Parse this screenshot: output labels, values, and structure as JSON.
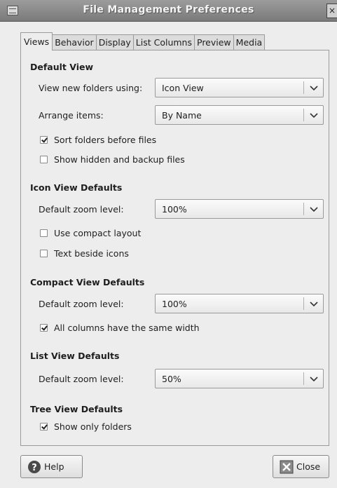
{
  "window": {
    "title": "File Management Preferences",
    "close_glyph": "×"
  },
  "tabs": [
    {
      "label": "Views",
      "active": true
    },
    {
      "label": "Behavior"
    },
    {
      "label": "Display"
    },
    {
      "label": "List Columns"
    },
    {
      "label": "Preview"
    },
    {
      "label": "Media"
    }
  ],
  "default_view": {
    "title": "Default View",
    "view_new_folders_label": "View new folders using:",
    "view_new_folders_value": "Icon View",
    "arrange_items_label": "Arrange items:",
    "arrange_items_value": "By Name",
    "sort_folders_label": "Sort folders before files",
    "sort_folders_checked": true,
    "show_hidden_label": "Show hidden and backup files",
    "show_hidden_checked": false
  },
  "icon_view": {
    "title": "Icon View Defaults",
    "zoom_label": "Default zoom level:",
    "zoom_value": "100%",
    "compact_layout_label": "Use compact layout",
    "compact_layout_checked": false,
    "text_beside_label": "Text beside icons",
    "text_beside_checked": false
  },
  "compact_view": {
    "title": "Compact View Defaults",
    "zoom_label": "Default zoom level:",
    "zoom_value": "100%",
    "same_width_label": "All columns have the same width",
    "same_width_checked": true
  },
  "list_view": {
    "title": "List View Defaults",
    "zoom_label": "Default zoom level:",
    "zoom_value": "50%"
  },
  "tree_view": {
    "title": "Tree View Defaults",
    "only_folders_label": "Show only folders",
    "only_folders_checked": true
  },
  "buttons": {
    "help": "Help",
    "close": "Close"
  },
  "icons": {
    "help": "help-icon",
    "close": "close-icon",
    "combo_arrow": "chevron-down-icon"
  }
}
